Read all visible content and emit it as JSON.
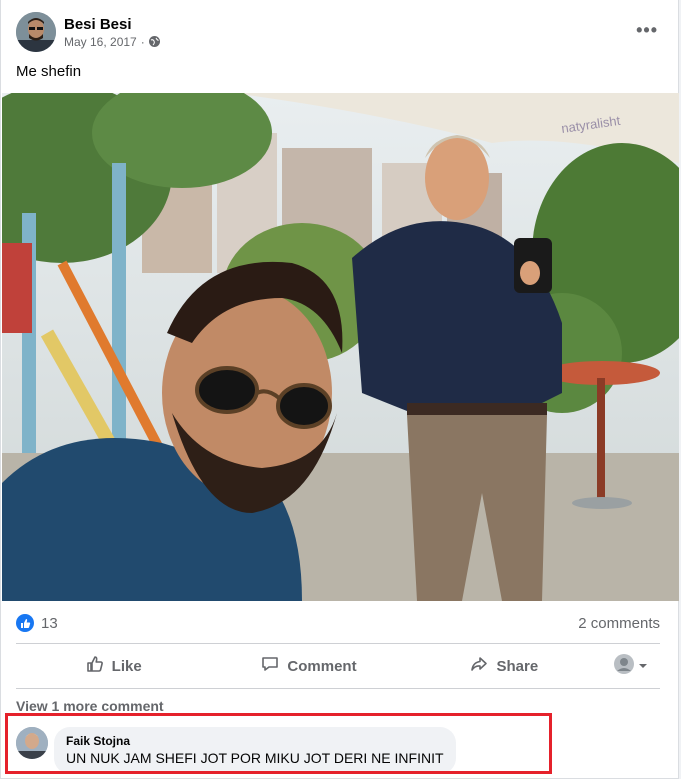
{
  "post": {
    "author": "Besi Besi",
    "date": "May 16, 2017",
    "separator": "·",
    "privacy_icon": "globe-icon",
    "more_icon": "more-options-icon",
    "caption": "Me shefin"
  },
  "reactions": {
    "icon": "like-icon",
    "count": "13",
    "comments_count": "2 comments"
  },
  "actions": {
    "like": "Like",
    "comment": "Comment",
    "share": "Share",
    "audience_icon": "chevron-down-icon"
  },
  "comments": {
    "view_more": "View 1 more comment",
    "items": [
      {
        "name": "Faik Stojna",
        "text": "UN NUK JAM SHEFI JOT POR MIKU JOT DERI NE INFINIT"
      }
    ]
  },
  "colors": {
    "brand": "#1877f2",
    "secondary_text": "#65676b",
    "highlight_box": "#e5212b"
  }
}
